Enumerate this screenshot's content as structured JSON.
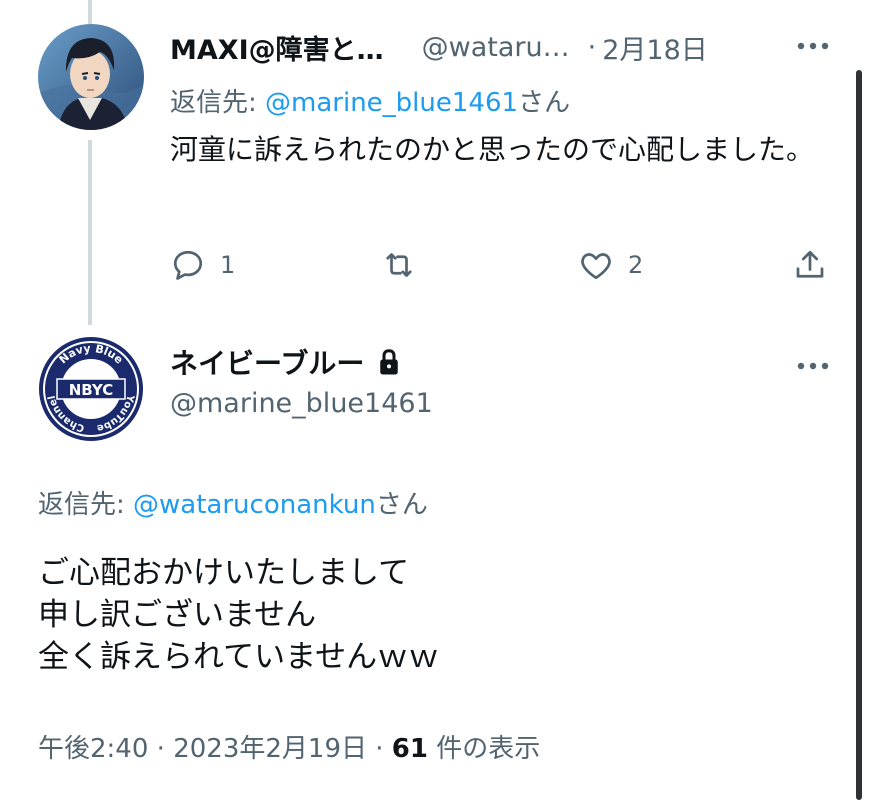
{
  "reply_tweet": {
    "display_name": "MAXI@障害と…",
    "handle": "@wataru…",
    "separator": "·",
    "date": "2月18日",
    "replying_prefix": "返信先: ",
    "replying_handle": "@marine_blue1461",
    "replying_suffix": "さん",
    "body": "河童に訴えられたのかと思ったので心配しました。",
    "reply_count": "1",
    "like_count": "2",
    "avatar_icon": "anime-character-avatar"
  },
  "main_tweet": {
    "display_name": "ネイビーブルー",
    "handle": "@marine_blue1461",
    "replying_prefix": "返信先: ",
    "replying_handle": "@wataruconankun",
    "replying_suffix": "さん",
    "lines": [
      "ご心配おかけいたしまして",
      "申し訳ございません",
      "全く訴えられていませんｗｗ"
    ],
    "time": "午後2:40",
    "meta_sep": "·",
    "date": "2023年2月19日",
    "views_count": "61",
    "views_label": "件の表示",
    "avatar": {
      "center_text": "NBYC",
      "ring_text_top": "Navy Blue",
      "ring_text_right": "YouTube",
      "ring_text_left": "Channel"
    }
  },
  "colors": {
    "text": "#0f1419",
    "secondary": "#536471",
    "link": "#1d9bf0",
    "thread_line": "#cfd9de",
    "navy": "#1a2a6c"
  }
}
